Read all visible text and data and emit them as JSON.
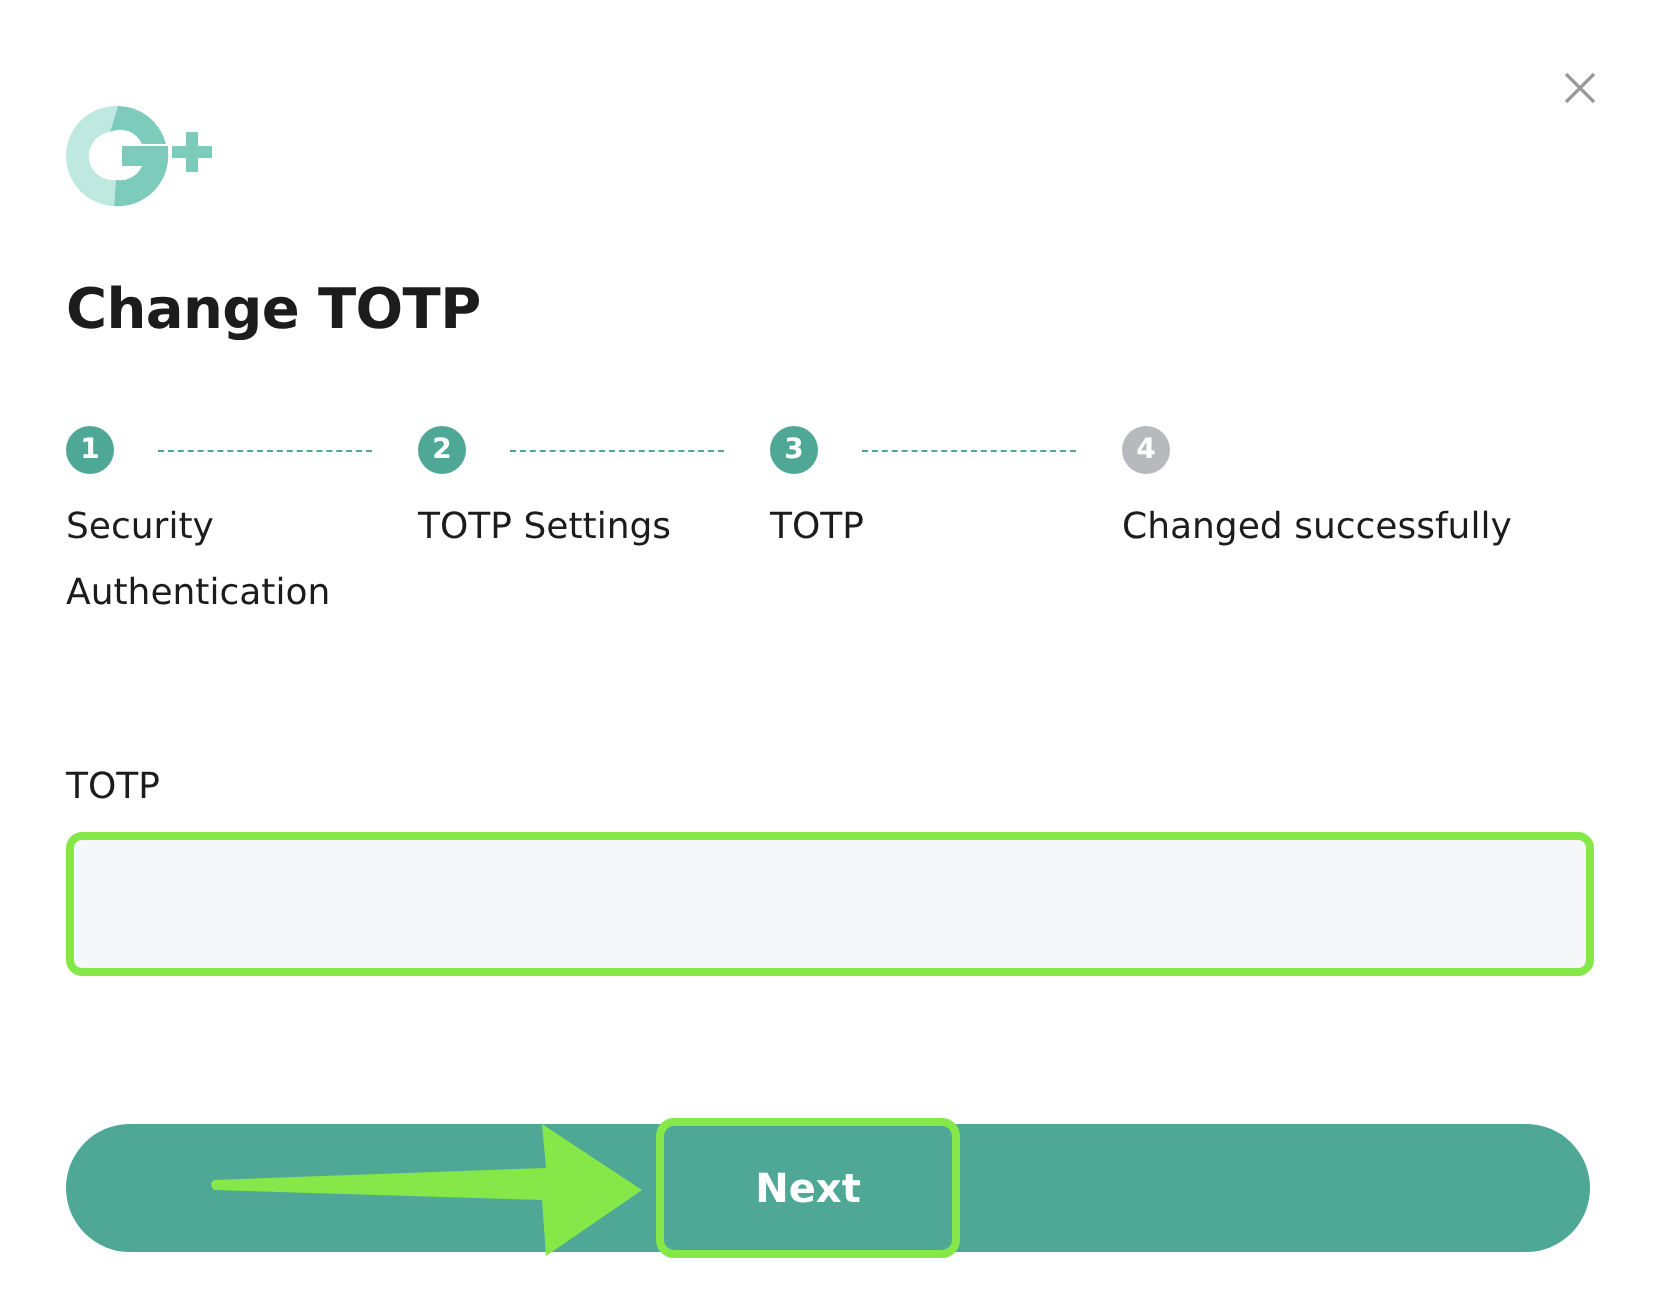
{
  "title": "Change TOTP",
  "steps": [
    {
      "number": "1",
      "label": "Security Authentication",
      "done": true
    },
    {
      "number": "2",
      "label": "TOTP Settings",
      "done": true
    },
    {
      "number": "3",
      "label": "TOTP",
      "done": true
    },
    {
      "number": "4",
      "label": "Changed successfully",
      "done": false
    }
  ],
  "field": {
    "label": "TOTP",
    "highlighted": true
  },
  "button": {
    "label": "Next",
    "highlighted": true
  }
}
